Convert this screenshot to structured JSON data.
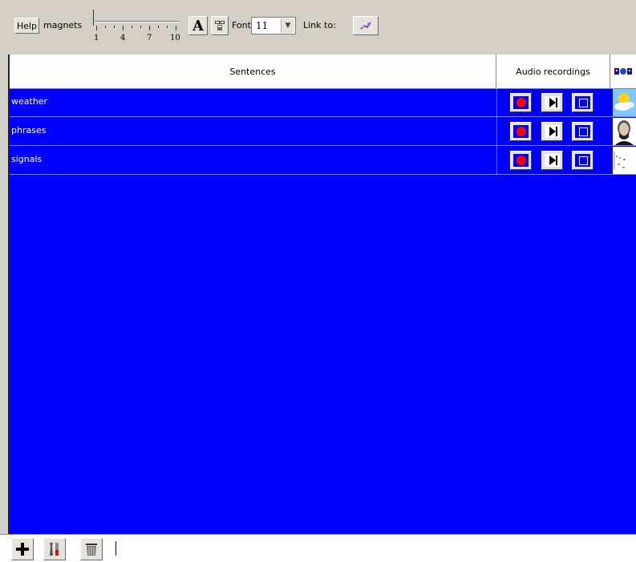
{
  "toolbar": {
    "help_label": "Help",
    "magnets_label": "magnets",
    "slider_ticks": [
      "1",
      "4",
      "7",
      "10"
    ],
    "slider_value": 1,
    "font_button_label": "A",
    "font_label": "Font:",
    "font_value": "11",
    "link_label": "Link to:"
  },
  "table": {
    "headers": {
      "sentences": "Sentences",
      "audio": "Audio recordings"
    },
    "rows": [
      {
        "label": "weather"
      },
      {
        "label": "phrases"
      },
      {
        "label": "signals"
      }
    ],
    "background_color": "#0000ff"
  },
  "icons": {
    "record": "record-icon",
    "play": "play-icon",
    "stop": "stop-icon",
    "add": "plus-icon",
    "tools": "tools-icon",
    "trash": "trash-icon"
  }
}
